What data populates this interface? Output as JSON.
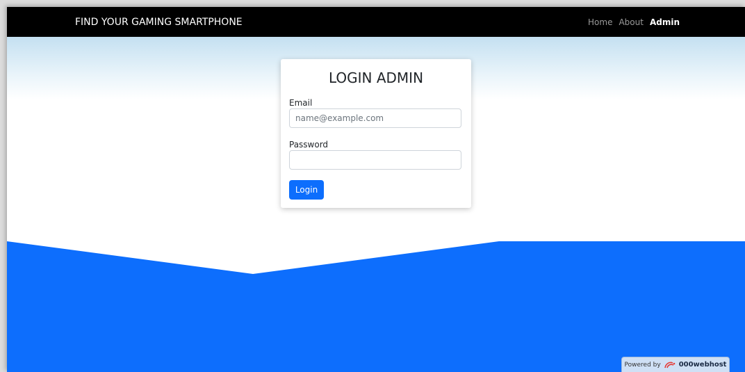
{
  "navbar": {
    "brand": "FIND YOUR GAMING SMARTPHONE",
    "links": [
      {
        "label": "Home",
        "active": false
      },
      {
        "label": "About",
        "active": false
      },
      {
        "label": "Admin",
        "active": true
      }
    ]
  },
  "login": {
    "title": "LOGIN ADMIN",
    "email_label": "Email",
    "email_placeholder": "name@example.com",
    "email_value": "",
    "password_label": "Password",
    "password_value": "",
    "submit_label": "Login"
  },
  "footer_badge": {
    "prefix": "Powered by",
    "brand": "000webhost",
    "icon": "000webhost-logo-icon"
  },
  "colors": {
    "navbar_bg": "#000000",
    "primary": "#0d6efd",
    "sky_top": "#c4e0f1",
    "wave": "#0d6efd"
  }
}
